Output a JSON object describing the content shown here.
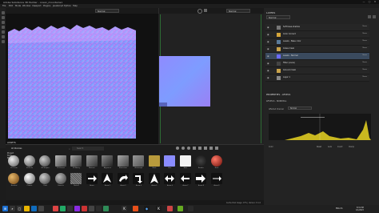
{
  "window": {
    "title": "Adobe Substance 3D Painter - ocean_mountains1",
    "minimize": "—",
    "maximize": "▢",
    "close": "✕"
  },
  "menu": [
    "File",
    "Edit",
    "Mode",
    "Window",
    "Viewport",
    "Plugins",
    "JavaScript",
    "Python",
    "Help"
  ],
  "viewport": {
    "left_mode": "Normal",
    "right_mode": "Normal"
  },
  "layers": {
    "title": "LAYERS",
    "channel": "Normal",
    "rows": [
      {
        "label": "Soft base shallow",
        "blend": "Norm",
        "selected": false,
        "color": "#777"
      },
      {
        "label": "Color Correct",
        "blend": "Norm",
        "selected": false,
        "color": "#d4a53a"
      },
      {
        "label": "Levels - Base color",
        "blend": "Norm",
        "selected": false,
        "color": "#5a7a9a"
      },
      {
        "label": "Grass mask",
        "blend": "Norm",
        "selected": false,
        "color": "#c8a24a"
      },
      {
        "label": "Levels - Normal",
        "blend": "Norm",
        "selected": true,
        "color": "#6a6aff"
      },
      {
        "label": "Filter (snow)",
        "blend": "Norm",
        "selected": false,
        "color": "#444"
      },
      {
        "label": "Ground mask",
        "blend": "Norm",
        "selected": false,
        "color": "#c8a24a"
      },
      {
        "label": "Layer 1",
        "blend": "Norm",
        "selected": false,
        "color": "#888"
      }
    ]
  },
  "properties": {
    "title": "PROPERTIES - LEVELS",
    "sub": "LEVELS - NORMAL",
    "affected_label": "Affected Channel",
    "affected_value": "Normal",
    "buttons": [
      "Reset",
      "Auto",
      "Invert",
      "Clamp"
    ],
    "mode": "Color"
  },
  "shelf": {
    "title": "ASSETS",
    "all_libraries": "All libraries",
    "search_placeholder": "Search",
    "libraries": [
      "Project",
      "Tools",
      "Materials",
      "Smart Mat.",
      "Filters",
      "Brushes",
      "Particles",
      "Textures",
      "Procedurals",
      "Environments",
      "Smart Masks",
      "Alphas",
      "Color Profiles"
    ],
    "row1": [
      "3D Linear",
      "3D Perlin",
      "3D Simplex",
      "3D Voronoi",
      "3D Worley",
      "Abstract",
      "Alignment",
      "Aluminium",
      "Anisotropic",
      "Black",
      "Blue",
      "Bolts",
      "Bomber",
      "Brick"
    ],
    "row2": [
      "Brushed",
      "Chrome",
      "Cloth",
      "Concrete",
      "Bolts B",
      "Arrow",
      "Arrow 2",
      "Arrow 3",
      "Arrow 4",
      "Arrow 5",
      "Arrow 6",
      "Arrow 7",
      "Arrow 8",
      "Arrow 9"
    ]
  },
  "status_text": "Cache Disk Usage: 97% | Version: 8.1.0",
  "taskbar": {
    "time": "8:31 PM",
    "date": "1/1/2023",
    "lang": "ENG US"
  },
  "colors": {
    "accent": "#4a7fd4",
    "green": "#2d6b34"
  }
}
